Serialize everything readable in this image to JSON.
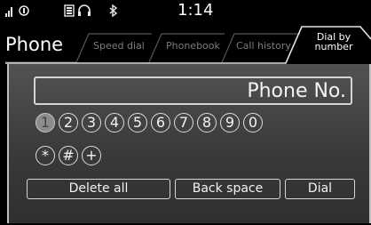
{
  "status": {
    "icons": [
      "signal-strength",
      "phone-connected",
      "phone-battery",
      "headset",
      "bluetooth"
    ],
    "time": "1:14"
  },
  "header": {
    "title": "Phone",
    "tabs": [
      {
        "label": "Speed dial",
        "active": false
      },
      {
        "label": "Phonebook",
        "active": false
      },
      {
        "label": "Call history",
        "active": false
      },
      {
        "label": "Dial by number",
        "line1": "Dial by",
        "line2": "number",
        "active": true
      }
    ]
  },
  "dialer": {
    "display_placeholder": "Phone No.",
    "keys": [
      "1",
      "2",
      "3",
      "4",
      "5",
      "6",
      "7",
      "8",
      "9",
      "0",
      "*",
      "#",
      "+"
    ],
    "selected_key": "1",
    "actions": {
      "delete_all": "Delete all",
      "back_space": "Back space",
      "dial": "Dial"
    }
  },
  "colors": {
    "selected_key": "#8c8c8c",
    "background_top": "#525252",
    "background_bottom": "#2f2f2f"
  }
}
